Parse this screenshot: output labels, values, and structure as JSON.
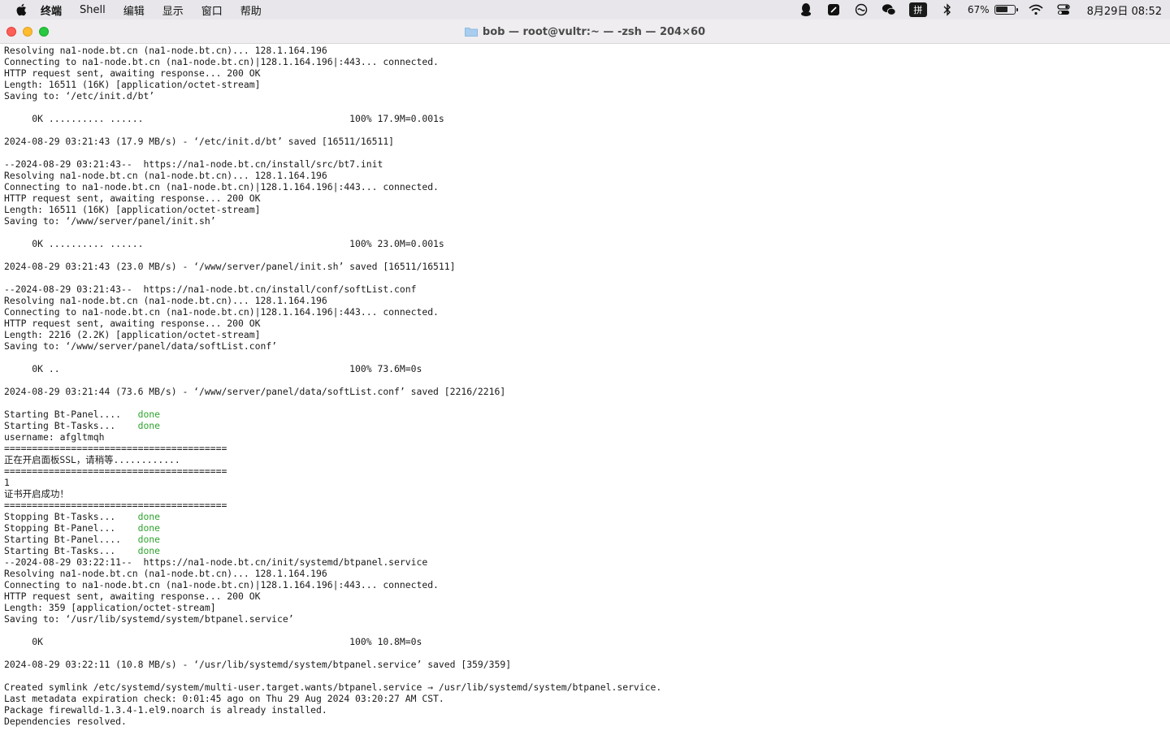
{
  "menubar": {
    "app_name": "终端",
    "items": [
      "Shell",
      "编辑",
      "显示",
      "窗口",
      "帮助"
    ],
    "status": {
      "battery_percent": "67%",
      "battery_level": 0.67,
      "input_method": "拼",
      "date": "8月29日",
      "time": "08:52"
    }
  },
  "window": {
    "title": "bob — root@vultr:~ — -zsh — 204×60"
  },
  "colors": {
    "done_green": "#2ea32e",
    "close": "#fe5f57",
    "minimize": "#febc2e",
    "maximize": "#28c840"
  },
  "terminal": {
    "lines": [
      {
        "text": "Resolving na1-node.bt.cn (na1-node.bt.cn)... 128.1.164.196"
      },
      {
        "text": "Connecting to na1-node.bt.cn (na1-node.bt.cn)|128.1.164.196|:443... connected."
      },
      {
        "text": "HTTP request sent, awaiting response... 200 OK"
      },
      {
        "text": "Length: 16511 (16K) [application/octet-stream]"
      },
      {
        "text": "Saving to: ‘/etc/init.d/bt’"
      },
      {
        "text": ""
      },
      {
        "text": "     0K .......... ......                                     100% 17.9M=0.001s"
      },
      {
        "text": ""
      },
      {
        "text": "2024-08-29 03:21:43 (17.9 MB/s) - ‘/etc/init.d/bt’ saved [16511/16511]"
      },
      {
        "text": ""
      },
      {
        "text": "--2024-08-29 03:21:43--  https://na1-node.bt.cn/install/src/bt7.init"
      },
      {
        "text": "Resolving na1-node.bt.cn (na1-node.bt.cn)... 128.1.164.196"
      },
      {
        "text": "Connecting to na1-node.bt.cn (na1-node.bt.cn)|128.1.164.196|:443... connected."
      },
      {
        "text": "HTTP request sent, awaiting response... 200 OK"
      },
      {
        "text": "Length: 16511 (16K) [application/octet-stream]"
      },
      {
        "text": "Saving to: ‘/www/server/panel/init.sh’"
      },
      {
        "text": ""
      },
      {
        "text": "     0K .......... ......                                     100% 23.0M=0.001s"
      },
      {
        "text": ""
      },
      {
        "text": "2024-08-29 03:21:43 (23.0 MB/s) - ‘/www/server/panel/init.sh’ saved [16511/16511]"
      },
      {
        "text": ""
      },
      {
        "text": "--2024-08-29 03:21:43--  https://na1-node.bt.cn/install/conf/softList.conf"
      },
      {
        "text": "Resolving na1-node.bt.cn (na1-node.bt.cn)... 128.1.164.196"
      },
      {
        "text": "Connecting to na1-node.bt.cn (na1-node.bt.cn)|128.1.164.196|:443... connected."
      },
      {
        "text": "HTTP request sent, awaiting response... 200 OK"
      },
      {
        "text": "Length: 2216 (2.2K) [application/octet-stream]"
      },
      {
        "text": "Saving to: ‘/www/server/panel/data/softList.conf’"
      },
      {
        "text": ""
      },
      {
        "text": "     0K ..                                                    100% 73.6M=0s"
      },
      {
        "text": ""
      },
      {
        "text": "2024-08-29 03:21:44 (73.6 MB/s) - ‘/www/server/panel/data/softList.conf’ saved [2216/2216]"
      },
      {
        "text": ""
      },
      {
        "text": "Starting Bt-Panel....   ",
        "status": "done"
      },
      {
        "text": "Starting Bt-Tasks...    ",
        "status": "done"
      },
      {
        "text": "username: afgltmqh"
      },
      {
        "text": "========================================"
      },
      {
        "text": "正在开启面板SSL，请稍等............"
      },
      {
        "text": "========================================"
      },
      {
        "text": "1"
      },
      {
        "text": "证书开启成功！"
      },
      {
        "text": "========================================"
      },
      {
        "text": "Stopping Bt-Tasks...    ",
        "status": "done"
      },
      {
        "text": "Stopping Bt-Panel...    ",
        "status": "done"
      },
      {
        "text": "Starting Bt-Panel....   ",
        "status": "done"
      },
      {
        "text": "Starting Bt-Tasks...    ",
        "status": "done"
      },
      {
        "text": "--2024-08-29 03:22:11--  https://na1-node.bt.cn/init/systemd/btpanel.service"
      },
      {
        "text": "Resolving na1-node.bt.cn (na1-node.bt.cn)... 128.1.164.196"
      },
      {
        "text": "Connecting to na1-node.bt.cn (na1-node.bt.cn)|128.1.164.196|:443... connected."
      },
      {
        "text": "HTTP request sent, awaiting response... 200 OK"
      },
      {
        "text": "Length: 359 [application/octet-stream]"
      },
      {
        "text": "Saving to: ‘/usr/lib/systemd/system/btpanel.service’"
      },
      {
        "text": ""
      },
      {
        "text": "     0K                                                       100% 10.8M=0s"
      },
      {
        "text": ""
      },
      {
        "text": "2024-08-29 03:22:11 (10.8 MB/s) - ‘/usr/lib/systemd/system/btpanel.service’ saved [359/359]"
      },
      {
        "text": ""
      },
      {
        "text": "Created symlink /etc/systemd/system/multi-user.target.wants/btpanel.service → /usr/lib/systemd/system/btpanel.service."
      },
      {
        "text": "Last metadata expiration check: 0:01:45 ago on Thu 29 Aug 2024 03:20:27 AM CST."
      },
      {
        "text": "Package firewalld-1.3.4-1.el9.noarch is already installed."
      },
      {
        "text": "Dependencies resolved."
      }
    ]
  }
}
